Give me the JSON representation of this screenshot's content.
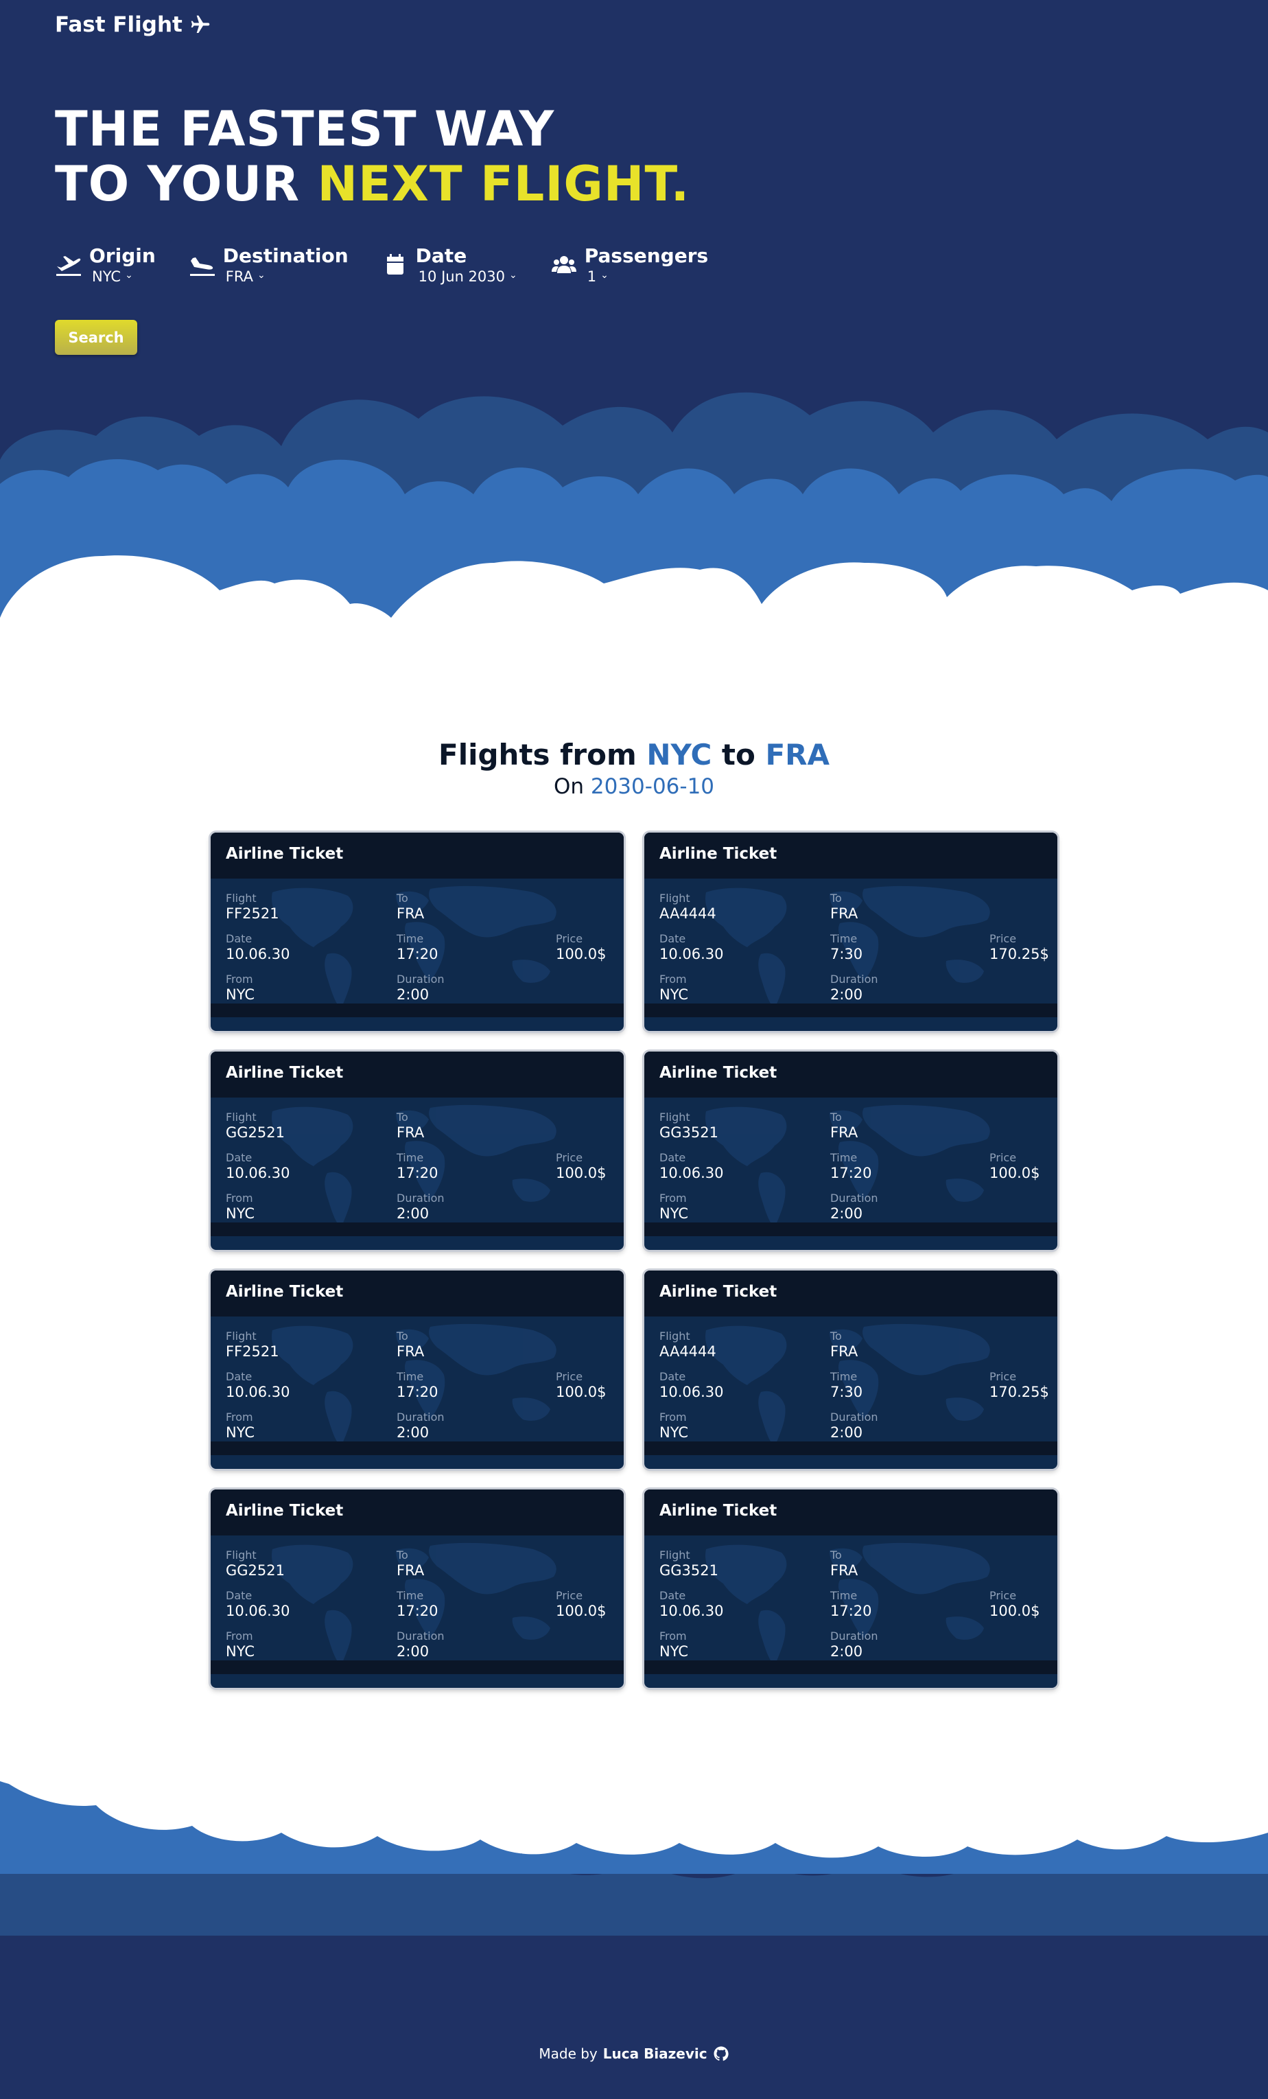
{
  "brand": {
    "name": "Fast Flight",
    "icon": "airplane-icon"
  },
  "hero": {
    "line1": "THE FASTEST WAY",
    "line2_prefix": "TO YOUR ",
    "line2_accent": "NEXT FLIGHT.",
    "accent_color": "#e8e22a",
    "background_color": "#1f3164"
  },
  "search": {
    "origin": {
      "label": "Origin",
      "value": "NYC",
      "icon": "plane-departure-icon"
    },
    "destination": {
      "label": "Destination",
      "value": "FRA",
      "icon": "plane-arrival-icon"
    },
    "date": {
      "label": "Date",
      "value": "10 Jun 2030",
      "icon": "calendar-icon"
    },
    "passengers": {
      "label": "Passengers",
      "value": "1",
      "icon": "users-icon"
    },
    "button_label": "Search"
  },
  "results": {
    "title_prefix": "Flights from ",
    "origin": "NYC",
    "title_mid": " to ",
    "destination": "FRA",
    "sub_prefix": "On ",
    "date": "2030-06-10",
    "highlight_color": "#2f6db8"
  },
  "ticket_labels": {
    "header": "Airline Ticket",
    "flight": "Flight",
    "to": "To",
    "date": "Date",
    "time": "Time",
    "price": "Price",
    "from": "From",
    "duration": "Duration"
  },
  "tickets": [
    {
      "flight": "FF2521",
      "to": "FRA",
      "date": "10.06.30",
      "time": "17:20",
      "price": "100.0$",
      "from": "NYC",
      "duration": "2:00"
    },
    {
      "flight": "AA4444",
      "to": "FRA",
      "date": "10.06.30",
      "time": "7:30",
      "price": "170.25$",
      "from": "NYC",
      "duration": "2:00"
    },
    {
      "flight": "GG2521",
      "to": "FRA",
      "date": "10.06.30",
      "time": "17:20",
      "price": "100.0$",
      "from": "NYC",
      "duration": "2:00"
    },
    {
      "flight": "GG3521",
      "to": "FRA",
      "date": "10.06.30",
      "time": "17:20",
      "price": "100.0$",
      "from": "NYC",
      "duration": "2:00"
    },
    {
      "flight": "FF2521",
      "to": "FRA",
      "date": "10.06.30",
      "time": "17:20",
      "price": "100.0$",
      "from": "NYC",
      "duration": "2:00"
    },
    {
      "flight": "AA4444",
      "to": "FRA",
      "date": "10.06.30",
      "time": "7:30",
      "price": "170.25$",
      "from": "NYC",
      "duration": "2:00"
    },
    {
      "flight": "GG2521",
      "to": "FRA",
      "date": "10.06.30",
      "time": "17:20",
      "price": "100.0$",
      "from": "NYC",
      "duration": "2:00"
    },
    {
      "flight": "GG3521",
      "to": "FRA",
      "date": "10.06.30",
      "time": "17:20",
      "price": "100.0$",
      "from": "NYC",
      "duration": "2:00"
    }
  ],
  "footer": {
    "prefix": "Made by ",
    "author": "Luca Biazevic",
    "icon": "github-icon"
  }
}
